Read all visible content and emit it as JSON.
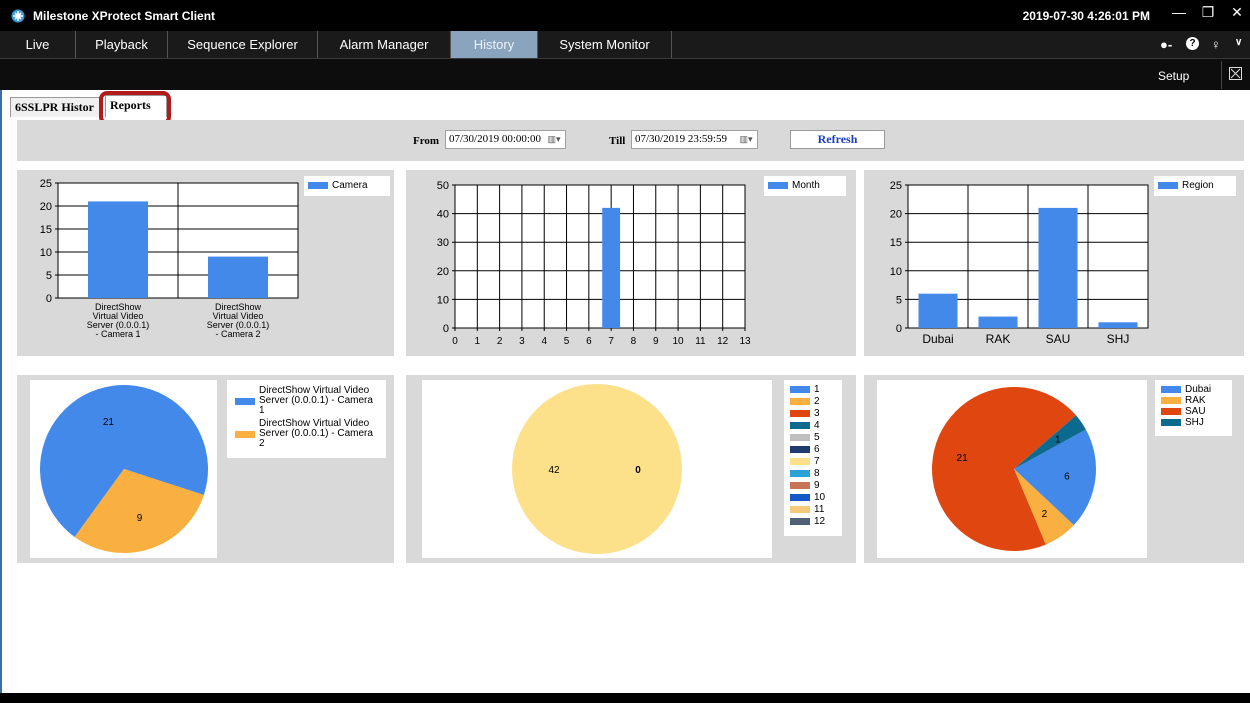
{
  "window": {
    "title": "Milestone XProtect Smart Client",
    "datetime": "2019-07-30 4:26:01 PM",
    "minimize": "—",
    "restore": "❐",
    "close": "✕"
  },
  "menu": {
    "tabs": [
      {
        "label": "Live"
      },
      {
        "label": "Playback"
      },
      {
        "label": "Sequence Explorer"
      },
      {
        "label": "Alarm Manager"
      },
      {
        "label": "History",
        "active": true
      },
      {
        "label": "System Monitor"
      }
    ],
    "icons": [
      "connection-icon",
      "help-icon",
      "key-icon",
      "chevron-down-icon"
    ]
  },
  "toolbar": {
    "setup_label": "Setup",
    "maximize_icon": "maximize-icon"
  },
  "subtabs": [
    {
      "label": "6SSLPR Histor"
    },
    {
      "label": "Reports",
      "active": true
    }
  ],
  "filter": {
    "from_label": "From",
    "from_value": "07/30/2019 00:00:00",
    "till_label": "Till",
    "till_value": "07/30/2019 23:59:59",
    "refresh_label": "Refresh"
  },
  "colors": {
    "bar": "#4389ea",
    "panel_bg": "#d9d9d9",
    "active_tab": "#8aa4bd",
    "highlight": "#b31b1b"
  },
  "chart_data": [
    {
      "type": "bar",
      "categories": [
        "DirectShow Virtual Video Server (0.0.0.1) - Camera 1",
        "DirectShow Virtual Video Server (0.0.0.1) - Camera 2"
      ],
      "category_lines": [
        [
          "DirectShow",
          "Virtual Video",
          "Server (0.0.0.1)",
          "- Camera 1"
        ],
        [
          "DirectShow",
          "Virtual Video",
          "Server (0.0.0.1)",
          "- Camera 2"
        ]
      ],
      "series": [
        {
          "name": "Camera",
          "values": [
            21,
            9
          ]
        }
      ],
      "ylim": [
        0,
        25
      ],
      "yticks": [
        0,
        5,
        10,
        15,
        20,
        25
      ],
      "grid": true,
      "legend": "top-right"
    },
    {
      "type": "bar",
      "x": [
        7
      ],
      "series": [
        {
          "name": "Month",
          "values": [
            42
          ]
        }
      ],
      "xlim": [
        0,
        13
      ],
      "xticks": [
        0,
        1,
        2,
        3,
        4,
        5,
        6,
        7,
        8,
        9,
        10,
        11,
        12,
        13
      ],
      "ylim": [
        0,
        50
      ],
      "yticks": [
        0,
        10,
        20,
        30,
        40,
        50
      ],
      "grid": true,
      "legend": "top-right"
    },
    {
      "type": "bar",
      "categories": [
        "Dubai",
        "RAK",
        "SAU",
        "SHJ"
      ],
      "series": [
        {
          "name": "Region",
          "values": [
            6,
            2,
            21,
            1
          ]
        }
      ],
      "ylim": [
        0,
        25
      ],
      "yticks": [
        0,
        5,
        10,
        15,
        20,
        25
      ],
      "grid": true,
      "legend": "top-right"
    },
    {
      "type": "pie",
      "labels": [
        "DirectShow Virtual Video Server (0.0.0.1) - Camera 1",
        "DirectShow Virtual Video Server (0.0.0.1) - Camera 2"
      ],
      "legend_lines": [
        [
          "DirectShow Virtual Video",
          "Server (0.0.0.1) - Camera",
          "1"
        ],
        [
          "DirectShow Virtual Video",
          "Server (0.0.0.1) - Camera",
          "2"
        ]
      ],
      "values": [
        21,
        9
      ],
      "colors": [
        "#4389ea",
        "#f9b040"
      ],
      "legend": "right"
    },
    {
      "type": "pie",
      "labels": [
        "1",
        "2",
        "3",
        "4",
        "5",
        "6",
        "7",
        "8",
        "9",
        "10",
        "11",
        "12"
      ],
      "values": [
        0,
        0,
        0,
        0,
        0,
        0,
        42,
        0,
        0,
        0,
        0,
        0
      ],
      "slice_labels": [
        "42",
        "0"
      ],
      "colors": [
        "#4389ea",
        "#f9b040",
        "#e0460f",
        "#0d6a8f",
        "#bfbfbf",
        "#1d3b6e",
        "#fde08a",
        "#2aa2d8",
        "#c77556",
        "#1457c9",
        "#f5c97a",
        "#4d6078"
      ],
      "legend": "right"
    },
    {
      "type": "pie",
      "labels": [
        "Dubai",
        "RAK",
        "SAU",
        "SHJ"
      ],
      "values": [
        6,
        2,
        21,
        1
      ],
      "colors": [
        "#4389ea",
        "#f9b040",
        "#e0460f",
        "#0d6a8f"
      ],
      "legend": "right"
    }
  ]
}
